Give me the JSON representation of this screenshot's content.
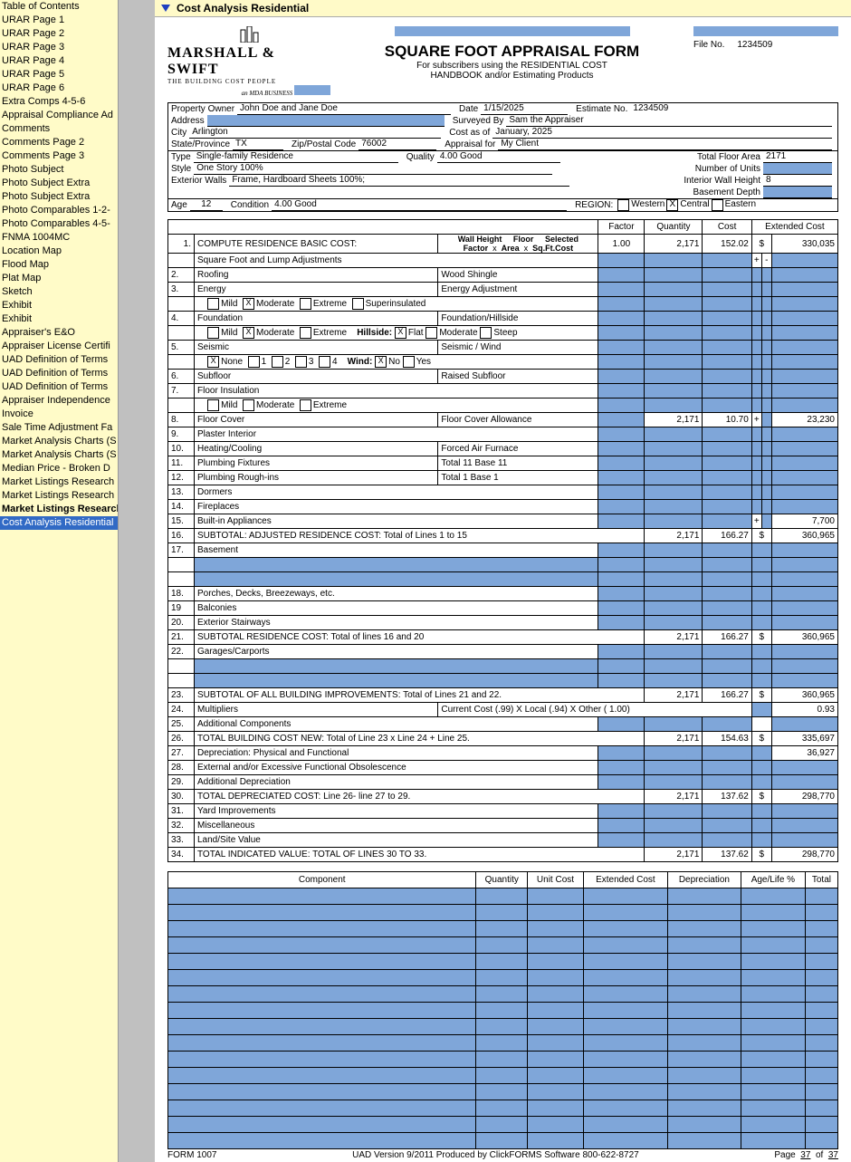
{
  "titlebar": "Cost Analysis Residential",
  "sidebar": [
    "Table of Contents",
    "URAR Page 1",
    "URAR Page 2",
    "URAR Page 3",
    "URAR Page 4",
    "URAR Page 5",
    "URAR Page 6",
    "Extra Comps 4-5-6",
    "Appraisal Compliance Ad",
    "Comments",
    "Comments Page 2",
    "Comments Page 3",
    "Photo Subject",
    "Photo Subject Extra",
    "Photo Subject Extra",
    "Photo Comparables 1-2-",
    "Photo Comparables 4-5-",
    "FNMA 1004MC",
    "Location Map",
    "Flood Map",
    "Plat Map",
    "Sketch",
    "Exhibit",
    "Exhibit",
    "Appraiser's E&O",
    "Appraiser License Certifi",
    "UAD Definition of Terms",
    "UAD Definition of Terms",
    "UAD Definition of Terms",
    "Appraiser Independence",
    "Invoice",
    "Sale Time Adjustment Fa",
    "Market Analysis Charts (S",
    "Market Analysis Charts (S",
    "Median Price - Broken D",
    "Market Listings Research",
    "Market Listings Research",
    "Market Listings Research",
    "Cost Analysis Residential"
  ],
  "sidebar_bold": 37,
  "sidebar_sel": 38,
  "form_title": "SQUARE FOOT APPRAISAL FORM",
  "form_sub1": "For subscribers using the RESIDENTIAL COST",
  "form_sub2": "HANDBOOK   and/or  Estimating   Products",
  "file_no_lbl": "File No.",
  "file_no": "1234509",
  "logo_brand": "MARSHALL & SWIFT",
  "logo_sub": "THE  BUILDING  COST  PEOPLE",
  "logo_tag": "an MDA BUSINESS",
  "info": {
    "owner_lbl": "Property Owner",
    "owner": "John Doe and Jane Doe",
    "date_lbl": "Date",
    "date": "1/15/2025",
    "estno_lbl": "Estimate   No.",
    "estno": "1234509",
    "addr_lbl": "Address",
    "addr": "",
    "surv_lbl": "Surveyed By",
    "surv": "Sam the Appraiser",
    "city_lbl": "City",
    "city": "Arlington",
    "costas_lbl": "Cost as of",
    "costas": "January, 2025",
    "state_lbl": "State/Province",
    "state": "TX",
    "zip_lbl": "Zip/Postal  Code",
    "zip": "76002",
    "apprfor_lbl": "Appraisal for",
    "apprfor": "My Client",
    "type_lbl": "Type",
    "type": "Single-family Residence",
    "qual_lbl": "Quality",
    "qual": "4.00 Good",
    "tfa_lbl": "Total Floor Area",
    "tfa": "2171",
    "style_lbl": "Style",
    "style": "One Story 100%",
    "units_lbl": "Number of Units",
    "units": "",
    "ext_lbl": "Exterior Walls",
    "ext": "Frame, Hardboard Sheets 100%;",
    "iwh_lbl": "Interior  Wall  Height",
    "iwh": "8",
    "bd_lbl": "Basement Depth",
    "bd": "",
    "age_lbl": "Age",
    "age": "12",
    "cond_lbl": "Condition",
    "cond": "4.00 Good",
    "region_lbl": "REGION:",
    "r1": "Western",
    "r2": "Central",
    "r3": "Eastern"
  },
  "thdr": {
    "factor": "Factor",
    "qty": "Quantity",
    "cost": "Cost",
    "ext": "Extended Cost",
    "whf": "Wall Height",
    "whf2": "Factor",
    "fa": "Floor",
    "fa2": "Area",
    "sc": "Selected",
    "sc2": "Sq.Ft.Cost",
    "x": "x"
  },
  "rows": {
    "r1": {
      "n": "1.",
      "t": "COMPUTE RESIDENCE BASIC COST:",
      "f": "1.00",
      "q": "2,171",
      "c": "152.02",
      "ext": "330,035",
      "cur": "$"
    },
    "r1b": "Square Foot and Lump Adjustments",
    "r2": {
      "n": "2.",
      "t": "Roofing",
      "v": "Wood Shingle"
    },
    "r3": {
      "n": "3.",
      "t": "Energy",
      "v": "Energy Adjustment",
      "opts": [
        "Mild",
        "Moderate",
        "Extreme",
        "Superinsulated"
      ],
      "chk": 1
    },
    "r4": {
      "n": "4.",
      "t": "Foundation",
      "v": "Foundation/Hillside",
      "opts": [
        "Mild",
        "Moderate",
        "Extreme"
      ],
      "chk": 1,
      "hlbl": "Hillside:",
      "hopts": [
        "Flat",
        "Moderate",
        "Steep"
      ],
      "hchk": 0
    },
    "r5": {
      "n": "5.",
      "t": "Seismic",
      "v": "Seismic / Wind",
      "opts": [
        "None",
        "1",
        "2",
        "3",
        "4"
      ],
      "chk": 0,
      "wlbl": "Wind:",
      "wopts": [
        "No",
        "Yes"
      ],
      "wchk": 0
    },
    "r6": {
      "n": "6.",
      "t": "Subfloor",
      "v": "Raised Subfloor"
    },
    "r7": {
      "n": "7.",
      "t": "Floor   Insulation",
      "opts": [
        "Mild",
        "Moderate",
        "Extreme"
      ]
    },
    "r8": {
      "n": "8.",
      "t": "Floor   Cover",
      "v": "Floor Cover Allowance",
      "q": "2,171",
      "c": "10.70",
      "pm": "+",
      "ext": "23,230"
    },
    "r9": {
      "n": "9.",
      "t": "Plaster   Interior"
    },
    "r10": {
      "n": "10.",
      "t": "Heating/Cooling",
      "v": "Forced Air Furnace"
    },
    "r11": {
      "n": "11.",
      "t": "Plumbing    Fixtures",
      "v": "Total 11 Base 11"
    },
    "r12": {
      "n": "12.",
      "t": "Plumbing    Rough-ins",
      "v": "Total 1  Base 1"
    },
    "r13": {
      "n": "13.",
      "t": "Dormers"
    },
    "r14": {
      "n": "14.",
      "t": "Fireplaces"
    },
    "r15": {
      "n": "15.",
      "t": "Built-in   Appliances",
      "pm": "+",
      "ext": "7,700"
    },
    "r16": {
      "n": "16.",
      "t": "SUBTOTAL: ADJUSTED RESIDENCE COST: Total of Lines 1 to 15",
      "q": "2,171",
      "c": "166.27",
      "cur": "$",
      "ext": "360,965"
    },
    "r17": {
      "n": "17.",
      "t": "Basement"
    },
    "r18": {
      "n": "18.",
      "t": "Porches, Decks, Breezeways, etc."
    },
    "r19": {
      "n": "19",
      "t": "Balconies"
    },
    "r20": {
      "n": "20.",
      "t": "Exterior Stairways"
    },
    "r21": {
      "n": "21.",
      "t": "SUBTOTAL RESIDENCE COST: Total of lines 16 and 20",
      "q": "2,171",
      "c": "166.27",
      "cur": "$",
      "ext": "360,965"
    },
    "r22": {
      "n": "22.",
      "t": "Garages/Carports"
    },
    "r23": {
      "n": "23.",
      "t": "SUBTOTAL OF ALL BUILDING IMPROVEMENTS: Total of Lines 21 and 22.",
      "q": "2,171",
      "c": "166.27",
      "cur": "$",
      "ext": "360,965"
    },
    "r24": {
      "n": "24.",
      "t": "Multipliers",
      "v": "Current Cost (.99) X Local (.94) X Other ( 1.00)",
      "ext": "0.93"
    },
    "r25": {
      "n": "25.",
      "t": "Additional    Components"
    },
    "r26": {
      "n": "26.",
      "t": "TOTAL BUILDING COST NEW:  Total of Line 23 x Line 24 + Line 25.",
      "q": "2,171",
      "c": "154.63",
      "cur": "$",
      "ext": "335,697"
    },
    "r27": {
      "n": "27.",
      "t": "Depreciation:  Physical  and   Functional",
      "ext": "36,927"
    },
    "r28": {
      "n": "28.",
      "t": "External  and/or  Excessive   Functional  Obsolescence"
    },
    "r29": {
      "n": "29.",
      "t": "Additional    Depreciation"
    },
    "r30": {
      "n": "30.",
      "t": "TOTAL DEPRECIATED COST: Line 26- line 27 to 29.",
      "q": "2,171",
      "c": "137.62",
      "cur": "$",
      "ext": "298,770"
    },
    "r31": {
      "n": "31.",
      "t": "Yard   Improvements"
    },
    "r32": {
      "n": "32.",
      "t": "Miscellaneous"
    },
    "r33": {
      "n": "33.",
      "t": "Land/Site   Value"
    },
    "r34": {
      "n": "34.",
      "t": "TOTAL INDICATED VALUE: TOTAL OF LINES 30 TO 33.",
      "q": "2,171",
      "c": "137.62",
      "cur": "$",
      "ext": "298,770"
    }
  },
  "ctbl": {
    "h": [
      "Component",
      "Quantity",
      "Unit  Cost",
      "Extended   Cost",
      "Depreciation",
      "Age/Life  %",
      "Total"
    ]
  },
  "footer": {
    "form": "FORM 1007",
    "mid": "UAD Version 9/2011 Produced by ClickFORMS Software 800-622-8727",
    "pg": "Page",
    "p1": "37",
    "of": "of",
    "p2": "37"
  }
}
